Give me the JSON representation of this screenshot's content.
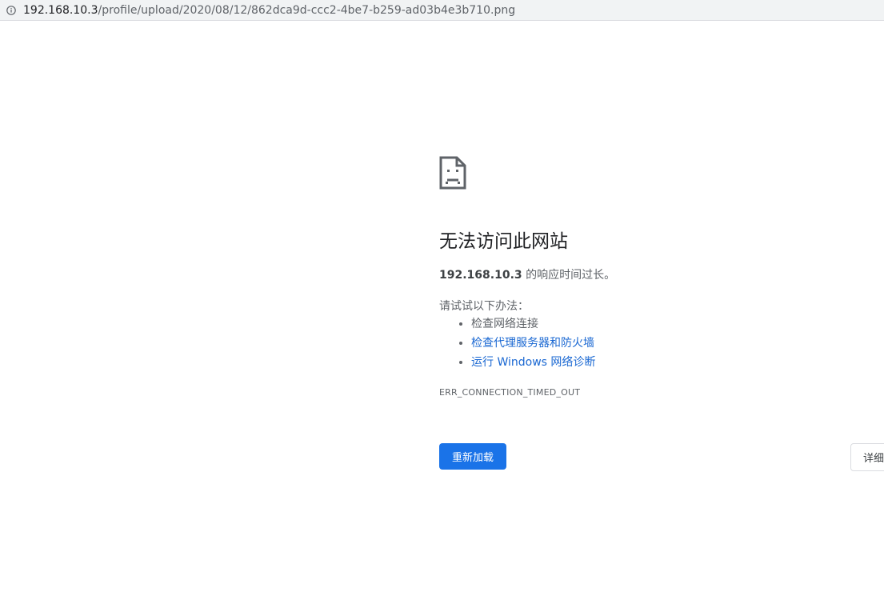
{
  "address_bar": {
    "url_host": "192.168.10.3",
    "url_path": "/profile/upload/2020/08/12/862dca9d-ccc2-4be7-b259-ad03b4e3b710.png",
    "icon": "info-icon"
  },
  "error": {
    "icon": "sad-page-icon",
    "title": "无法访问此网站",
    "host": "192.168.10.3",
    "message_suffix": " 的响应时间过长。",
    "suggest_label": "请试试以下办法：",
    "suggestions": [
      {
        "label": "检查网络连接",
        "link": false
      },
      {
        "label": "检查代理服务器和防火墙",
        "link": true
      },
      {
        "label": "运行 Windows 网络诊断",
        "link": true
      }
    ],
    "code": "ERR_CONNECTION_TIMED_OUT"
  },
  "buttons": {
    "reload_label": "重新加载",
    "details_label": "详细"
  },
  "colors": {
    "primary": "#1a73e8",
    "link": "#1967d2",
    "text": "#202124",
    "secondary_text": "#5f6368"
  }
}
